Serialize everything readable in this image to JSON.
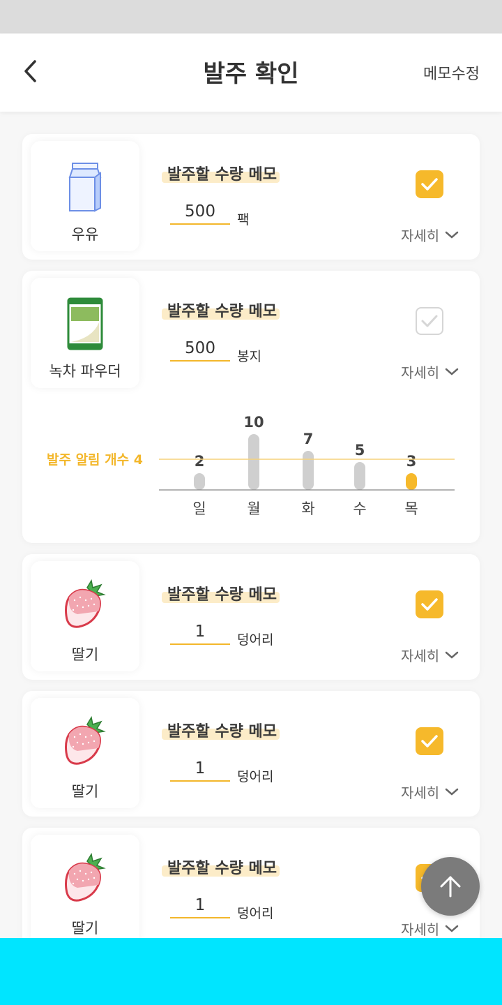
{
  "header": {
    "title": "발주 확인",
    "right_action": "메모수정",
    "back_icon": "chevron-left-icon"
  },
  "colors": {
    "accent": "#f6b92b",
    "highlight": "#fcecc8",
    "bottom_bar": "#00e5ff",
    "fab": "#7b7b7b"
  },
  "items": [
    {
      "name": "우유",
      "icon": "milk-carton-icon",
      "memo_title": "발주할 수량 메모",
      "quantity": "500",
      "unit": "팩",
      "checked": true,
      "detail_label": "자세히"
    },
    {
      "name": "녹차 파우더",
      "icon": "green-tea-powder-icon",
      "memo_title": "발주할 수량 메모",
      "quantity": "500",
      "unit": "봉지",
      "checked": false,
      "detail_label": "자세히",
      "expanded": true
    },
    {
      "name": "딸기",
      "icon": "strawberry-icon",
      "memo_title": "발주할 수량 메모",
      "quantity": "1",
      "unit": "덩어리",
      "checked": true,
      "detail_label": "자세히"
    },
    {
      "name": "딸기",
      "icon": "strawberry-icon",
      "memo_title": "발주할 수량 메모",
      "quantity": "1",
      "unit": "덩어리",
      "checked": true,
      "detail_label": "자세히"
    },
    {
      "name": "딸기",
      "icon": "strawberry-icon",
      "memo_title": "발주할 수량 메모",
      "quantity": "1",
      "unit": "덩어리",
      "checked": true,
      "detail_label": "자세히"
    }
  ],
  "order_alert": {
    "label": "발주 알림 개수 4",
    "threshold": 4
  },
  "chart_data": {
    "type": "bar",
    "categories": [
      "일",
      "월",
      "화",
      "수",
      "목"
    ],
    "values": [
      2,
      10,
      7,
      5,
      3
    ],
    "highlight_index": 4,
    "threshold": 4,
    "ylim": [
      0,
      10
    ],
    "grid": false
  },
  "fab": {
    "icon": "arrow-up-icon"
  }
}
